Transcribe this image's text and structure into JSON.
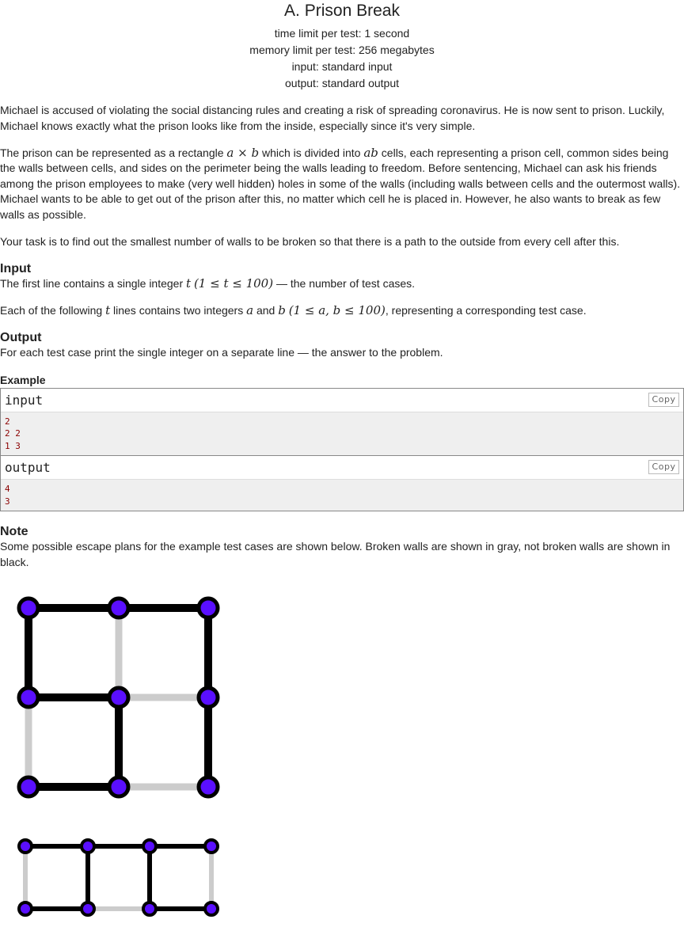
{
  "problem": {
    "title": "A. Prison Break",
    "time_limit": "time limit per test: 1 second",
    "memory_limit": "memory limit per test: 256 megabytes",
    "input_type": "input: standard input",
    "output_type": "output: standard output"
  },
  "statement": {
    "p1": "Michael is accused of violating the social distancing rules and creating a risk of spreading coronavirus. He is now sent to prison. Luckily, Michael knows exactly what the prison looks like from the inside, especially since it's very simple.",
    "p2_a": "The prison can be represented as a rectangle ",
    "p2_math1": "a × b",
    "p2_b": " which is divided into ",
    "p2_math2": "ab",
    "p2_c": " cells, each representing a prison cell, common sides being the walls between cells, and sides on the perimeter being the walls leading to freedom. Before sentencing, Michael can ask his friends among the prison employees to make (very well hidden) holes in some of the walls (including walls between cells and the outermost walls). Michael wants to be able to get out of the prison after this, no matter which cell he is placed in. However, he also wants to break as few walls as possible.",
    "p3": "Your task is to find out the smallest number of walls to be broken so that there is a path to the outside from every cell after this."
  },
  "input_section": {
    "title": "Input",
    "l1_a": "The first line contains a single integer ",
    "l1_math1": "t",
    "l1_math2": "(1 ≤ t ≤ 100)",
    "l1_b": " — the number of test cases.",
    "l2_a": "Each of the following ",
    "l2_math1": "t",
    "l2_b": " lines contains two integers ",
    "l2_math2": "a",
    "l2_c": " and ",
    "l2_math3": "b",
    "l2_math4": "(1 ≤ a, b ≤ 100)",
    "l2_d": ", representing a corresponding test case."
  },
  "output_section": {
    "title": "Output",
    "text": "For each test case print the single integer on a separate line — the answer to the problem."
  },
  "example": {
    "title": "Example",
    "copy_label": "Copy",
    "input_label": "input",
    "input_lines": [
      "2",
      "2 2",
      "1 3"
    ],
    "output_label": "output",
    "output_lines": [
      "4",
      "3"
    ]
  },
  "note": {
    "title": "Note",
    "text": "Some possible escape plans for the example test cases are shown below. Broken walls are shown in gray, not broken walls are shown in black."
  },
  "colors": {
    "vertex": "#5a0fff",
    "wall": "#000000",
    "broken_wall": "#cccccc"
  }
}
